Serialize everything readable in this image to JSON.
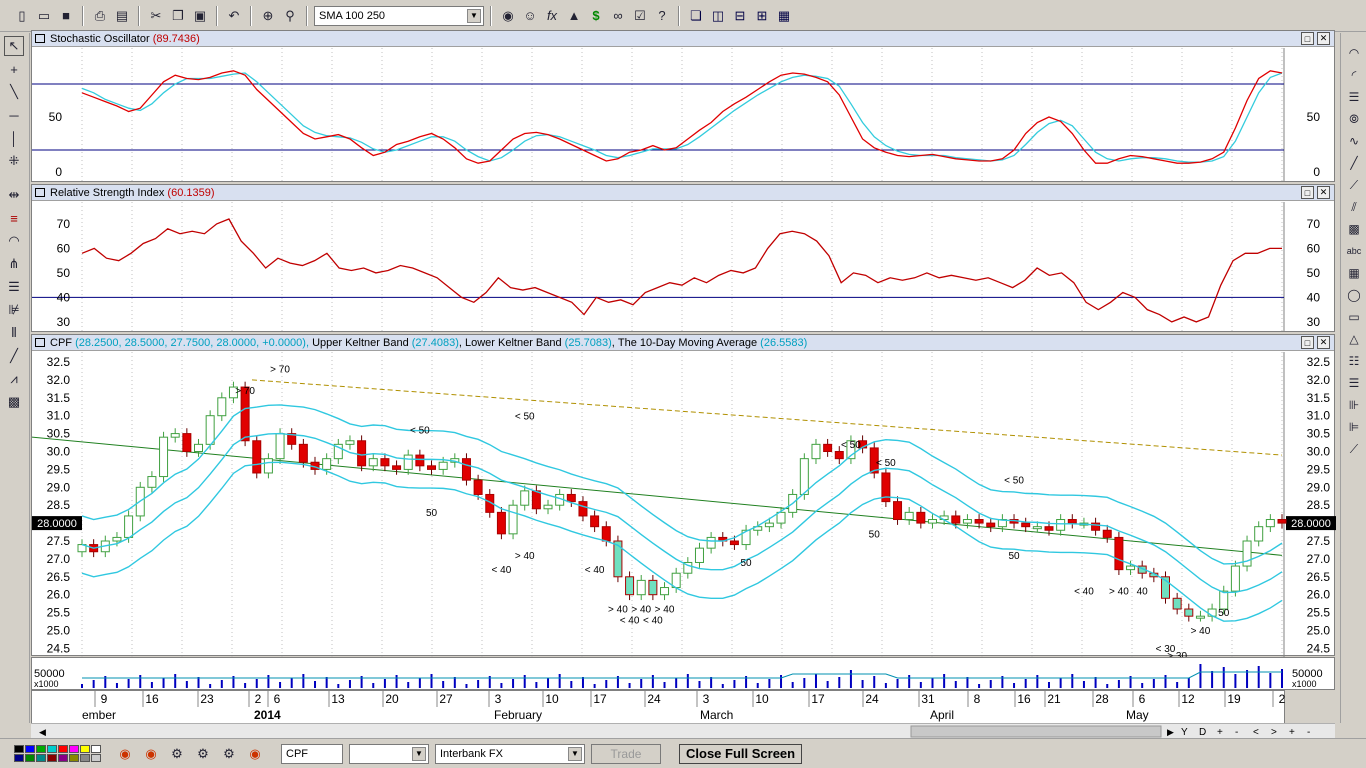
{
  "toolbar": {
    "indicator_combo": "SMA 100 250",
    "icons": [
      "new-icon",
      "open-icon",
      "save-icon",
      "print-icon",
      "print-preview-icon",
      "cut-icon",
      "copy-icon",
      "paste-icon",
      "undo-icon",
      "crosshair-icon",
      "zoom-icon",
      "portfolio-icon",
      "user-icon",
      "formula-icon",
      "chart-icon",
      "dollar-icon",
      "binoculars-icon",
      "checklist-icon",
      "help-icon",
      "cascade-icon",
      "tile-vertical-icon",
      "tile-horizontal-icon",
      "grid-icon",
      "layout-icon"
    ]
  },
  "left_tools": [
    "pointer-icon",
    "crosshair-tool-icon",
    "trendline-icon",
    "hline-icon",
    "vline-icon",
    "fib-icon",
    "zoom-tool-icon",
    "channel-icon",
    "arc-icon",
    "pitchfork-icon",
    "fan-icon",
    "gann-icon",
    "cycles-icon",
    "line-icon",
    "speedline-icon",
    "grid-tool-icon"
  ],
  "right_tools": [
    "arc-right-icon",
    "arc2-icon",
    "fib-right-icon",
    "ellipse-icon",
    "wave-icon",
    "diagonal-icon",
    "diag2-icon",
    "diag3-icon",
    "pattern-icon",
    "text-abc-icon",
    "table-icon",
    "ellipse2-icon",
    "rect-icon",
    "triangle-icon",
    "bars-icon",
    "bars2-icon",
    "bars3-icon",
    "bars4-icon",
    "polyline-icon"
  ],
  "panes": {
    "stoch": {
      "title": "Stochastic Oscillator",
      "value": "(89.7436)",
      "ticks": [
        "50",
        "0"
      ],
      "series_k": [
        72,
        68,
        64,
        60,
        55,
        58,
        70,
        82,
        88,
        85,
        84,
        86,
        90,
        92,
        88,
        75,
        65,
        55,
        45,
        35,
        30,
        32,
        34,
        30,
        22,
        15,
        18,
        25,
        28,
        32,
        35,
        30,
        22,
        12,
        8,
        10,
        20,
        30,
        35,
        36,
        34,
        30,
        25,
        20,
        15,
        10,
        12,
        18,
        20,
        24,
        20,
        22,
        30,
        38,
        45,
        55,
        62,
        68,
        75,
        82,
        88,
        90,
        89,
        86,
        82,
        70,
        50,
        30,
        22,
        18,
        15,
        14,
        15,
        16,
        14,
        12,
        11,
        10,
        10,
        12,
        20,
        35,
        45,
        50,
        46,
        35,
        20,
        8,
        8,
        12,
        15,
        14,
        12,
        10,
        8,
        8,
        9,
        12,
        18,
        40,
        65,
        85,
        92,
        90
      ],
      "series_d": [
        76,
        72,
        66,
        62,
        58,
        56,
        62,
        72,
        80,
        85,
        85,
        85,
        87,
        89,
        90,
        82,
        72,
        62,
        52,
        42,
        36,
        33,
        32,
        31,
        27,
        21,
        18,
        20,
        24,
        28,
        32,
        32,
        28,
        20,
        14,
        10,
        13,
        20,
        28,
        33,
        34,
        32,
        28,
        24,
        20,
        15,
        13,
        15,
        18,
        21,
        21,
        21,
        25,
        32,
        40,
        48,
        56,
        63,
        70,
        76,
        82,
        86,
        88,
        87,
        85,
        78,
        62,
        45,
        32,
        24,
        19,
        16,
        15,
        15,
        15,
        13,
        12,
        11,
        10,
        11,
        15,
        25,
        36,
        44,
        47,
        42,
        30,
        18,
        12,
        10,
        12,
        13,
        13,
        12,
        10,
        9,
        9,
        10,
        14,
        28,
        50,
        72,
        86,
        90
      ],
      "lines": [
        80,
        20
      ]
    },
    "rsi": {
      "title": "Relative Strength Index",
      "value": "(60.1359)",
      "ticks": [
        "70",
        "60",
        "50",
        "40",
        "30"
      ],
      "series": [
        58,
        60,
        56,
        55,
        58,
        62,
        64,
        68,
        66,
        67,
        66,
        70,
        72,
        63,
        58,
        52,
        56,
        54,
        53,
        55,
        58,
        52,
        51,
        52,
        50,
        51,
        53,
        52,
        50,
        48,
        44,
        40,
        38,
        42,
        48,
        44,
        43,
        44,
        42,
        40,
        38,
        33,
        40,
        38,
        39,
        37,
        42,
        44,
        46,
        45,
        48,
        46,
        49,
        51,
        50,
        52,
        60,
        66,
        67,
        66,
        63,
        57,
        46,
        50,
        49,
        46,
        48,
        47,
        48,
        50,
        48,
        49,
        48,
        47,
        48,
        46,
        44,
        47,
        52,
        49,
        50,
        46,
        38,
        35,
        38,
        42,
        40,
        35,
        33,
        30,
        32,
        30,
        32,
        45,
        55,
        58,
        58,
        60,
        60
      ],
      "line": 40
    },
    "price": {
      "title": "CPF",
      "ohlc": "(28.2500, 28.5000, 27.7500, 28.0000, +0.0000),",
      "upper_label": "Upper Keltner Band",
      "upper_value": "(27.4083)",
      "lower_label": "Lower Keltner Band",
      "lower_value": "(25.7083)",
      "ma_label": "The 10-Day Moving Average",
      "ma_value": "(26.5583)",
      "last_price": "28.0000",
      "ticks": [
        "32.5",
        "32.0",
        "31.5",
        "31.0",
        "30.5",
        "30.0",
        "29.5",
        "29.0",
        "28.5",
        "28.0",
        "27.5",
        "27.0",
        "26.5",
        "26.0",
        "25.5",
        "25.0",
        "24.5"
      ],
      "signals": [
        {
          "text": "> 70"
        },
        {
          "text": "> 70"
        },
        {
          "text": "< 50"
        },
        {
          "text": "< 50"
        },
        {
          "text": "50"
        },
        {
          "text": "> 40"
        },
        {
          "text": "< 40"
        },
        {
          "text": "< 40"
        },
        {
          "text": "> 40"
        },
        {
          "text": "> 40"
        },
        {
          "text": "> 40"
        },
        {
          "text": "< 40"
        },
        {
          "text": "< 40"
        },
        {
          "text": "50"
        },
        {
          "text": "< 50"
        },
        {
          "text": "< 50"
        },
        {
          "text": "50"
        },
        {
          "text": "< 50"
        },
        {
          "text": "50"
        },
        {
          "text": "< 40"
        },
        {
          "text": "> 40"
        },
        {
          "text": "40"
        },
        {
          "text": "< 30"
        },
        {
          "text": "> 30"
        },
        {
          "text": "> 40"
        },
        {
          "text": "50"
        }
      ]
    },
    "volume": {
      "label": "50000",
      "unit": "x1000"
    }
  },
  "dates": {
    "days": [
      "9",
      "16",
      "23",
      "2",
      "6",
      "13",
      "20",
      "27",
      "3",
      "10",
      "17",
      "24",
      "3",
      "10",
      "17",
      "24",
      "31",
      "8",
      "16",
      "21",
      "28",
      "6",
      "12",
      "19",
      "2"
    ],
    "months": [
      "ember",
      "2014",
      "February",
      "March",
      "April",
      "May"
    ]
  },
  "scroll_buttons": [
    "Y",
    "D",
    "+",
    "-",
    "<",
    ">",
    "+",
    "-"
  ],
  "status": {
    "symbol": "CPF",
    "second_combo": "",
    "feed": "Interbank FX",
    "trade": "Trade",
    "close_full": "Close Full Screen"
  }
}
